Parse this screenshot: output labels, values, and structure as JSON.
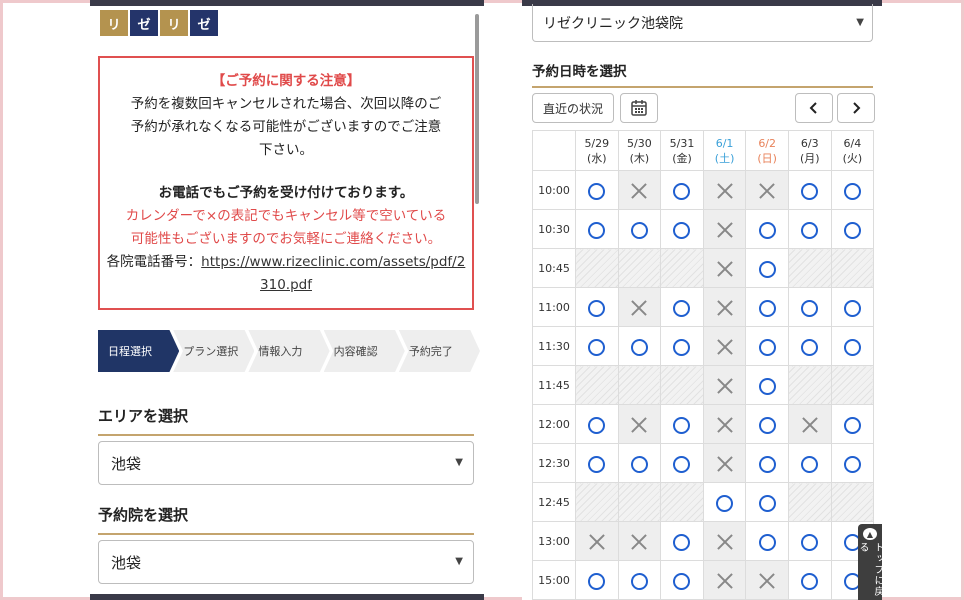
{
  "logo": {
    "char1": "リ",
    "char2": "ゼ",
    "char3": "リ",
    "char4": "ゼ"
  },
  "notice": {
    "title": "【ご予約に関する注意】",
    "line1": "予約を複数回キャンセルされた場合、次回以降のご",
    "line2": "予約が承れなくなる可能性がございますのでご注意",
    "line3": "下さい。",
    "phone_title": "お電話でもご予約を受け付けております。",
    "red1": "カレンダーで×の表記でもキャンセル等で空いている",
    "red2": "可能性もございますのでお気軽にご連絡ください。",
    "phone_label": "各院電話番号：",
    "link1": "https://www.rizeclinic.com/assets/pdf/2",
    "link2": "310.pdf"
  },
  "steps": [
    "日程選択",
    "プラン選択",
    "情報入力",
    "内容確認",
    "予約完了"
  ],
  "area": {
    "heading": "エリアを選択",
    "value": "池袋"
  },
  "clinic": {
    "heading": "予約院を選択",
    "value": "池袋"
  },
  "right": {
    "clinic_value": "リゼクリニック池袋院",
    "date_heading": "予約日時を選択",
    "recent_button": "直近の状況",
    "prev_label": "<",
    "next_label": ">",
    "totop_label": "トップに戻る",
    "totop_icon": "chevron-up-icon"
  },
  "schedule": {
    "days": [
      {
        "date": "5/29",
        "dow": "(水)",
        "type": "normal"
      },
      {
        "date": "5/30",
        "dow": "(木)",
        "type": "normal"
      },
      {
        "date": "5/31",
        "dow": "(金)",
        "type": "normal"
      },
      {
        "date": "6/1",
        "dow": "(土)",
        "type": "sat"
      },
      {
        "date": "6/2",
        "dow": "(日)",
        "type": "sun"
      },
      {
        "date": "6/3",
        "dow": "(月)",
        "type": "normal"
      },
      {
        "date": "6/4",
        "dow": "(火)",
        "type": "normal"
      }
    ],
    "rows": [
      {
        "time": "10:00",
        "cells": [
          "o",
          "x",
          "o",
          "x",
          "x",
          "o",
          "o"
        ]
      },
      {
        "time": "10:30",
        "cells": [
          "o",
          "o",
          "o",
          "x",
          "o",
          "o",
          "o"
        ]
      },
      {
        "time": "10:45",
        "cells": [
          "-",
          "-",
          "-",
          "x",
          "o",
          "-",
          "-"
        ]
      },
      {
        "time": "11:00",
        "cells": [
          "o",
          "x",
          "o",
          "x",
          "o",
          "o",
          "o"
        ]
      },
      {
        "time": "11:30",
        "cells": [
          "o",
          "o",
          "o",
          "x",
          "o",
          "o",
          "o"
        ]
      },
      {
        "time": "11:45",
        "cells": [
          "-",
          "-",
          "-",
          "x",
          "o",
          "-",
          "-"
        ]
      },
      {
        "time": "12:00",
        "cells": [
          "o",
          "x",
          "o",
          "x",
          "o",
          "x",
          "o"
        ]
      },
      {
        "time": "12:30",
        "cells": [
          "o",
          "o",
          "o",
          "x",
          "o",
          "o",
          "o"
        ]
      },
      {
        "time": "12:45",
        "cells": [
          "-",
          "-",
          "-",
          "o",
          "o",
          "-",
          "-"
        ]
      },
      {
        "time": "13:00",
        "cells": [
          "x",
          "x",
          "o",
          "x",
          "o",
          "o",
          "o"
        ]
      },
      {
        "time": "15:00",
        "cells": [
          "o",
          "o",
          "o",
          "x",
          "x",
          "o",
          "o"
        ]
      }
    ]
  }
}
